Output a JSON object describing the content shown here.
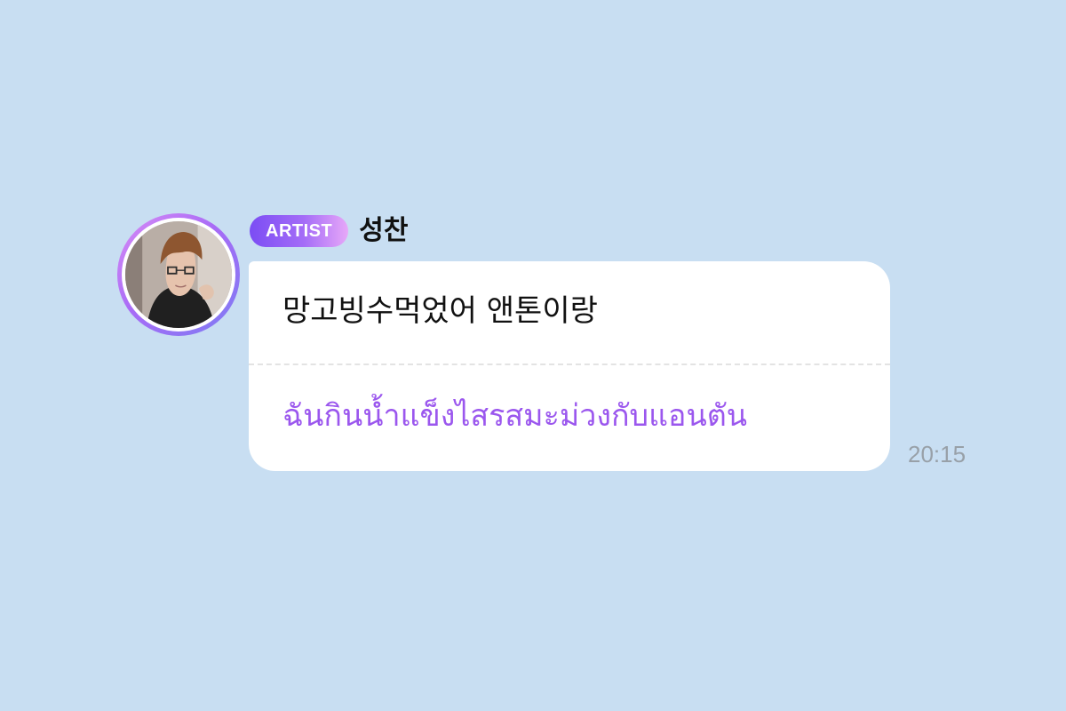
{
  "message": {
    "badge": "ARTIST",
    "sender": "성찬",
    "original_text": "망고빙수먹었어 앤톤이랑",
    "translated_text": "ฉันกินน้ำแข็งไสรสมะม่วงกับแอนตัน",
    "time": "20:15"
  },
  "colors": {
    "background": "#c8def2",
    "bubble": "#ffffff",
    "translation": "#9b57ee",
    "badge_start": "#7b4df4",
    "badge_end": "#e7a8f8",
    "timestamp": "#98a0a8"
  },
  "icons": {
    "avatar": "profile-photo"
  }
}
